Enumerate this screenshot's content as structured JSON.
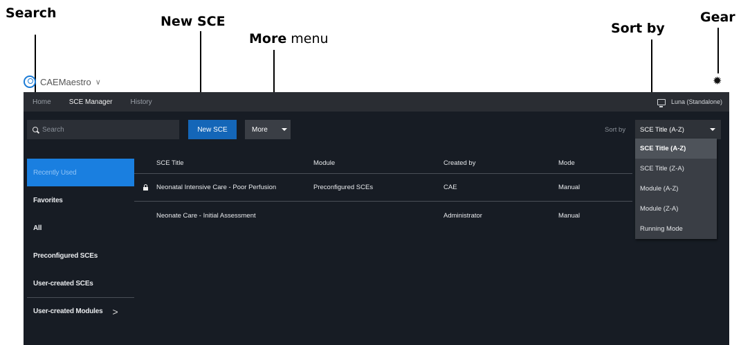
{
  "annotations": {
    "search": "Search",
    "new_sce": "New SCE",
    "more_bold": "More",
    "more_rest": " menu",
    "sort_by": "Sort by",
    "gear": "Gear"
  },
  "app": {
    "brand_name": "CAEMaestro",
    "brand_chevron": "∨",
    "gear_glyph": "✹"
  },
  "navbar": {
    "items": [
      "Home",
      "SCE Manager",
      "History"
    ],
    "active_index": 1,
    "station_label": "Luna (Standalone)"
  },
  "toolbar": {
    "search_placeholder": "Search",
    "new_sce_label": "New SCE",
    "more_label": "More",
    "sort_by_label": "Sort by",
    "sort_selected": "SCE Title (A-Z)"
  },
  "sidebar": {
    "items": [
      {
        "label": "Recently Used",
        "active": true
      },
      {
        "label": "Favorites"
      },
      {
        "label": "All"
      },
      {
        "label": "Preconfigured SCEs"
      },
      {
        "label": "User-created SCEs"
      },
      {
        "label": "User-created Modules",
        "arrow": ">"
      }
    ]
  },
  "table": {
    "columns": [
      "SCE Title",
      "Module",
      "Created by",
      "Mode"
    ],
    "rows": [
      {
        "locked": true,
        "title": "Neonatal Intensive Care - Poor Perfusion",
        "module": "Preconfigured SCEs",
        "created_by": "CAE",
        "mode": "Manual"
      },
      {
        "locked": false,
        "title": "Neonate Care - Initial Assessment",
        "module": "",
        "created_by": "Administrator",
        "mode": "Manual"
      }
    ]
  },
  "sort_dropdown": {
    "options": [
      "SCE Title (A-Z)",
      "SCE Title (Z-A)",
      "Module (A-Z)",
      "Module (Z-A)",
      "Running Mode"
    ],
    "selected_index": 0
  },
  "colors": {
    "accent_blue": "#1466b8",
    "active_sidebar": "#1a7fe0",
    "app_background": "#171c24"
  }
}
